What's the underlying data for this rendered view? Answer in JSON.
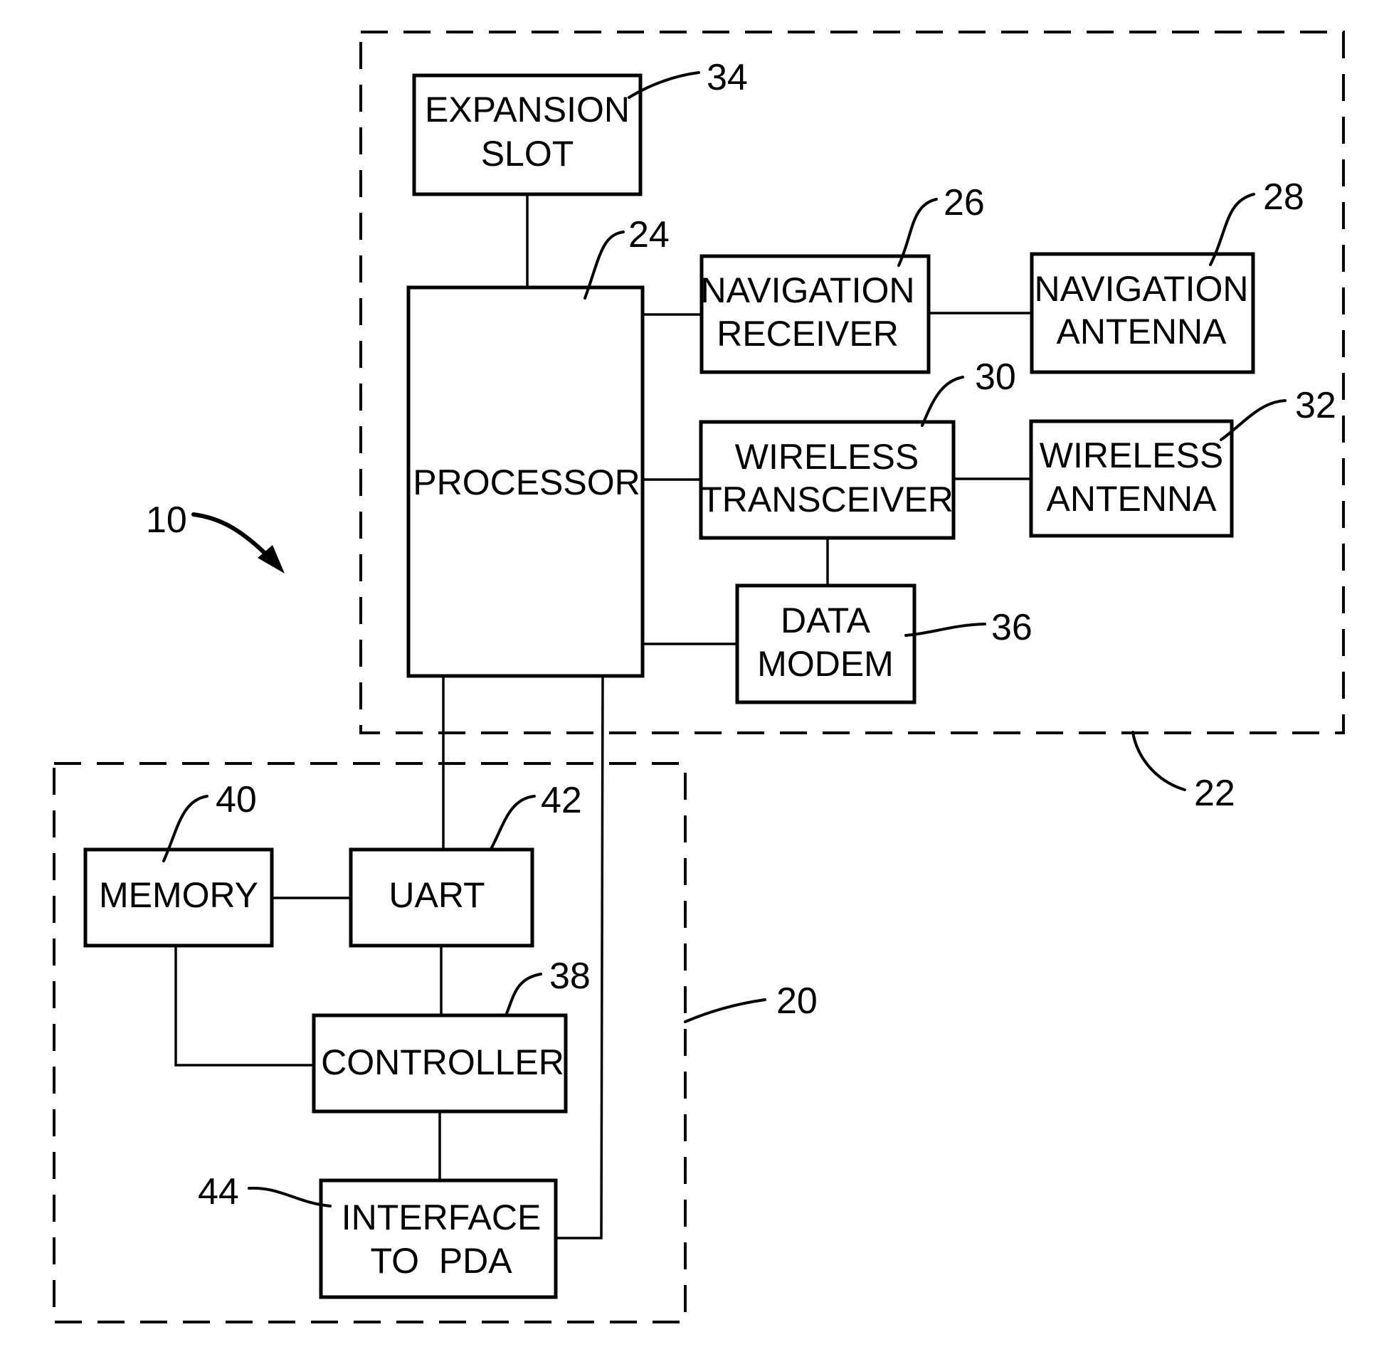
{
  "figure": {
    "system_ref": "10",
    "groups": [
      {
        "id": "module_22",
        "ref": "22",
        "style": "dashed"
      },
      {
        "id": "module_20",
        "ref": "20",
        "style": "dashed"
      }
    ],
    "blocks": {
      "expansion_slot": {
        "ref": "34",
        "lines": [
          "EXPANSION",
          "SLOT"
        ]
      },
      "processor": {
        "ref": "24",
        "lines": [
          "PROCESSOR"
        ]
      },
      "navigation_receiver": {
        "ref": "26",
        "lines": [
          "NAVIGATION",
          "RECEIVER"
        ]
      },
      "navigation_antenna": {
        "ref": "28",
        "lines": [
          "NAVIGATION",
          "ANTENNA"
        ]
      },
      "wireless_transceiver": {
        "ref": "30",
        "lines": [
          "WIRELESS",
          "TRANSCEIVER"
        ]
      },
      "wireless_antenna": {
        "ref": "32",
        "lines": [
          "WIRELESS",
          "ANTENNA"
        ]
      },
      "data_modem": {
        "ref": "36",
        "lines": [
          "DATA",
          "MODEM"
        ]
      },
      "memory": {
        "ref": "40",
        "lines": [
          "MEMORY"
        ]
      },
      "uart": {
        "ref": "42",
        "lines": [
          "UART"
        ]
      },
      "controller": {
        "ref": "38",
        "lines": [
          "CONTROLLER"
        ]
      },
      "interface_to_pda": {
        "ref": "44",
        "lines": [
          "INTERFACE",
          "TO  PDA"
        ]
      }
    },
    "connections": [
      [
        "expansion_slot",
        "processor"
      ],
      [
        "processor",
        "navigation_receiver"
      ],
      [
        "navigation_receiver",
        "navigation_antenna"
      ],
      [
        "processor",
        "wireless_transceiver"
      ],
      [
        "wireless_transceiver",
        "wireless_antenna"
      ],
      [
        "wireless_transceiver",
        "data_modem"
      ],
      [
        "processor",
        "data_modem"
      ],
      [
        "processor",
        "uart"
      ],
      [
        "processor",
        "interface_to_pda"
      ],
      [
        "memory",
        "uart"
      ],
      [
        "memory",
        "controller"
      ],
      [
        "uart",
        "controller"
      ],
      [
        "controller",
        "interface_to_pda"
      ]
    ]
  }
}
